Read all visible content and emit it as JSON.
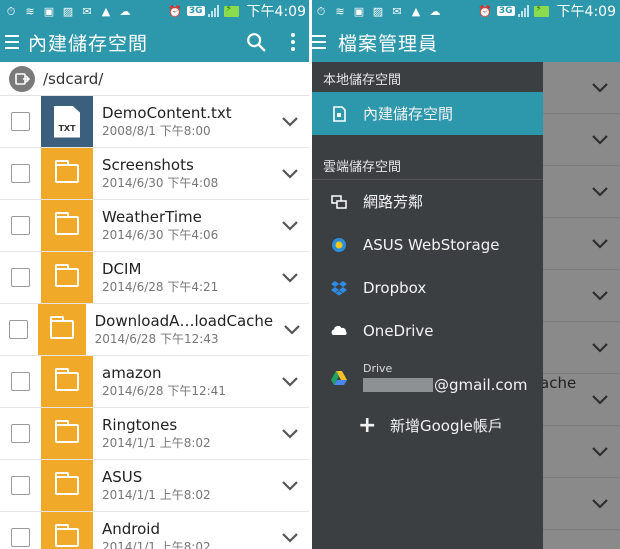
{
  "status": {
    "time": "下午4:09",
    "network": "3G"
  },
  "left": {
    "title": "內建儲存空間",
    "path": "/sdcard/",
    "files": [
      {
        "name": "DemoContent.txt",
        "date": "2008/8/1 下午8:00",
        "type": "txt",
        "type_label": "TXT"
      },
      {
        "name": "Screenshots",
        "date": "2014/6/30 下午4:08",
        "type": "folder"
      },
      {
        "name": "WeatherTime",
        "date": "2014/6/30 下午4:06",
        "type": "folder"
      },
      {
        "name": "DCIM",
        "date": "2014/6/28 下午4:21",
        "type": "folder"
      },
      {
        "name": "DownloadA…loadCache",
        "date": "2014/6/28 下午12:43",
        "type": "folder"
      },
      {
        "name": "amazon",
        "date": "2014/6/28 下午12:41",
        "type": "folder"
      },
      {
        "name": "Ringtones",
        "date": "2014/1/1 上午8:02",
        "type": "folder"
      },
      {
        "name": "ASUS",
        "date": "2014/1/1 上午8:02",
        "type": "folder"
      },
      {
        "name": "Android",
        "date": "2014/1/1 上午8:02",
        "type": "folder"
      }
    ]
  },
  "right": {
    "title": "檔案管理員",
    "background_text": "ache",
    "drawer": {
      "local_header": "本地儲存空間",
      "local_items": [
        {
          "label": "內建儲存空間",
          "icon": "sd-card-icon",
          "selected": true
        }
      ],
      "cloud_header": "雲端儲存空間",
      "cloud_items": [
        {
          "label": "網路芳鄰",
          "icon": "network-icon"
        },
        {
          "label": "ASUS WebStorage",
          "icon": "asus-webstorage-icon"
        },
        {
          "label": "Dropbox",
          "icon": "dropbox-icon"
        },
        {
          "label": "OneDrive",
          "icon": "onedrive-icon"
        }
      ],
      "drive": {
        "label": "Drive",
        "account_suffix": "@gmail.com"
      },
      "add_account": "新增Google帳戶"
    }
  },
  "colors": {
    "primary": "#2d97ac",
    "folder": "#f0a928",
    "txt": "#3b5f7d",
    "drawer": "#3c3f42"
  }
}
